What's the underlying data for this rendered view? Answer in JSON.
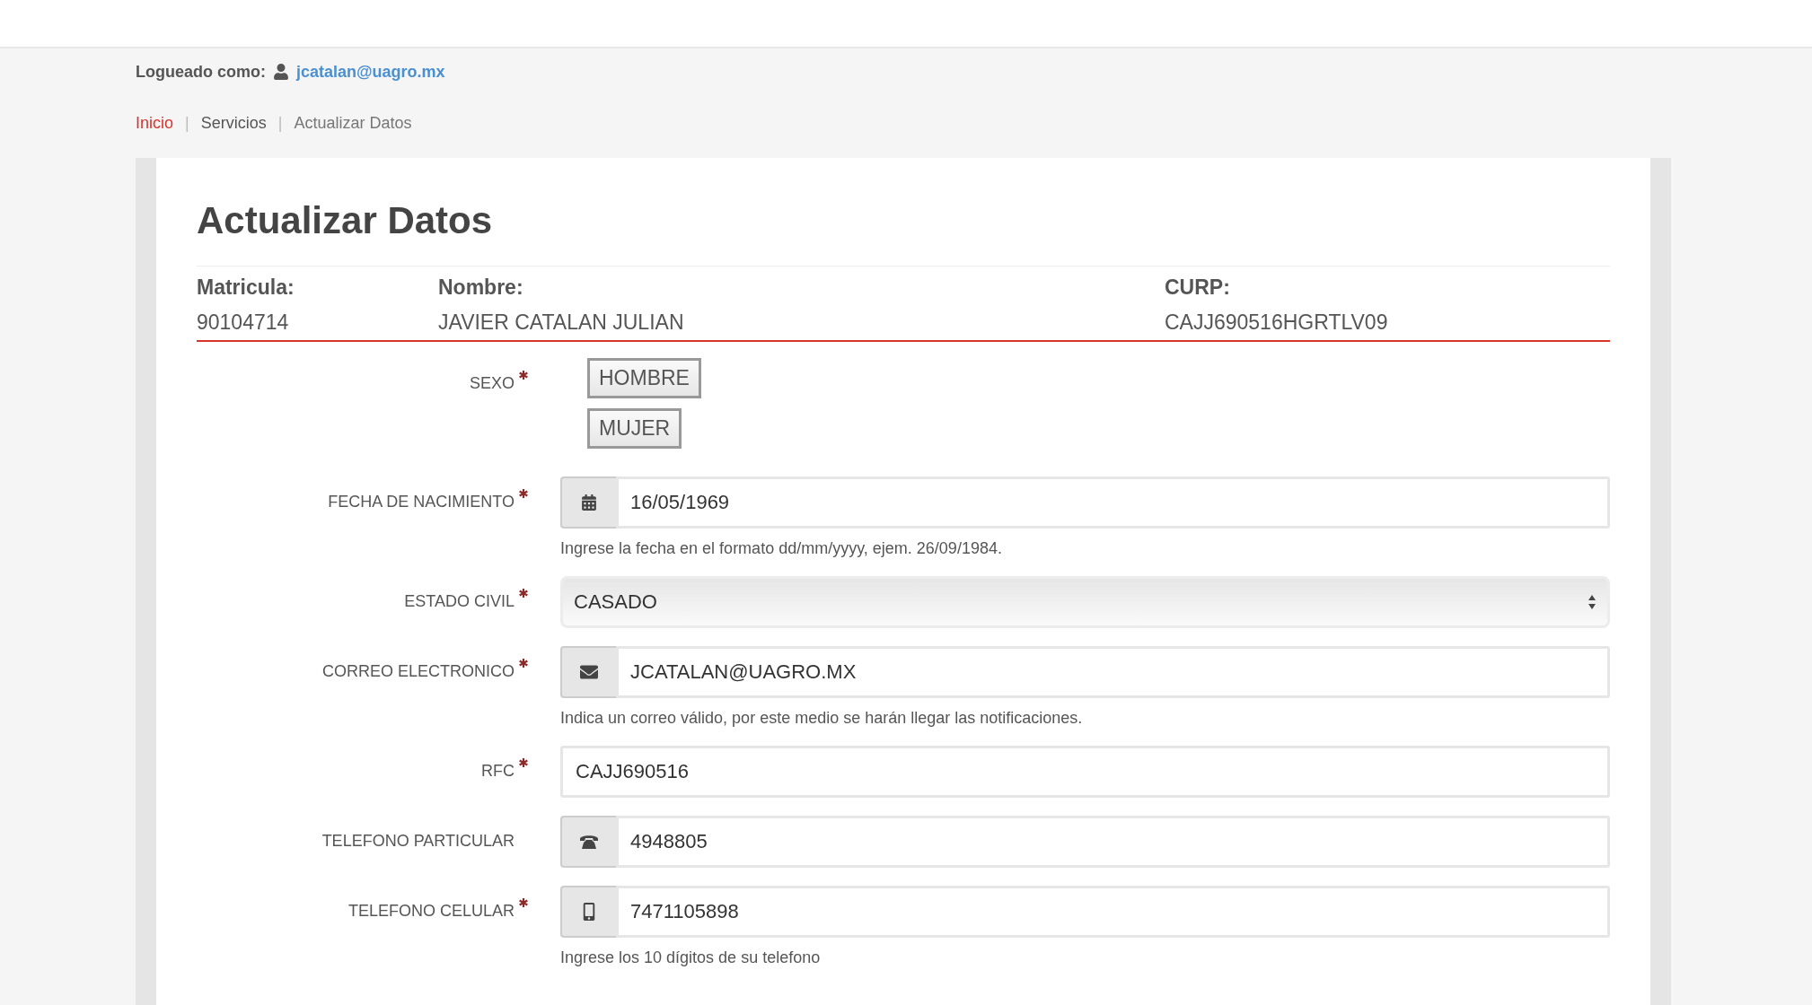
{
  "session": {
    "label": "Logueado como:",
    "user": "jcatalan@uagro.mx"
  },
  "breadcrumb": [
    {
      "label": "Inicio",
      "kind": "home"
    },
    {
      "label": "|",
      "kind": "separator"
    },
    {
      "label": "Servicios",
      "kind": "link"
    },
    {
      "label": "|",
      "kind": "separator"
    },
    {
      "label": "Actualizar Datos",
      "kind": "current"
    }
  ],
  "page_title": "Actualizar Datos",
  "info": [
    {
      "label": "Matricula:",
      "value": "90104714"
    },
    {
      "label": "Nombre:",
      "value": "JAVIER CATALAN JULIAN"
    },
    {
      "label": "CURP:",
      "value": "CAJJ690516HGRTLV09"
    }
  ],
  "fields": [
    {
      "kind": "choices",
      "label": "SEXO",
      "required": true,
      "options": [
        "HOMBRE",
        "MUJER"
      ]
    },
    {
      "kind": "date",
      "label": "FECHA DE NACIMIENTO",
      "required": true,
      "value": "16/05/1969",
      "help": "Ingrese la fecha en el formato dd/mm/yyyy, ejem. 26/09/1984."
    },
    {
      "kind": "select",
      "label": "ESTADO CIVIL",
      "required": true,
      "value": "CASADO"
    },
    {
      "kind": "email",
      "label": "CORREO ELECTRONICO",
      "required": true,
      "value": "JCATALAN@UAGRO.MX",
      "help": "Indica un correo válido, por este medio se harán llegar las notificaciones."
    },
    {
      "kind": "text",
      "label": "RFC",
      "required": true,
      "value": "CAJJ690516"
    },
    {
      "kind": "phone",
      "label": "TELEFONO PARTICULAR",
      "required": false,
      "value": "4948805"
    },
    {
      "kind": "mobile",
      "label": "TELEFONO CELULAR",
      "required": true,
      "value": "7471105898",
      "help": "Ingrese los 10 dígitos de su telefono"
    }
  ]
}
